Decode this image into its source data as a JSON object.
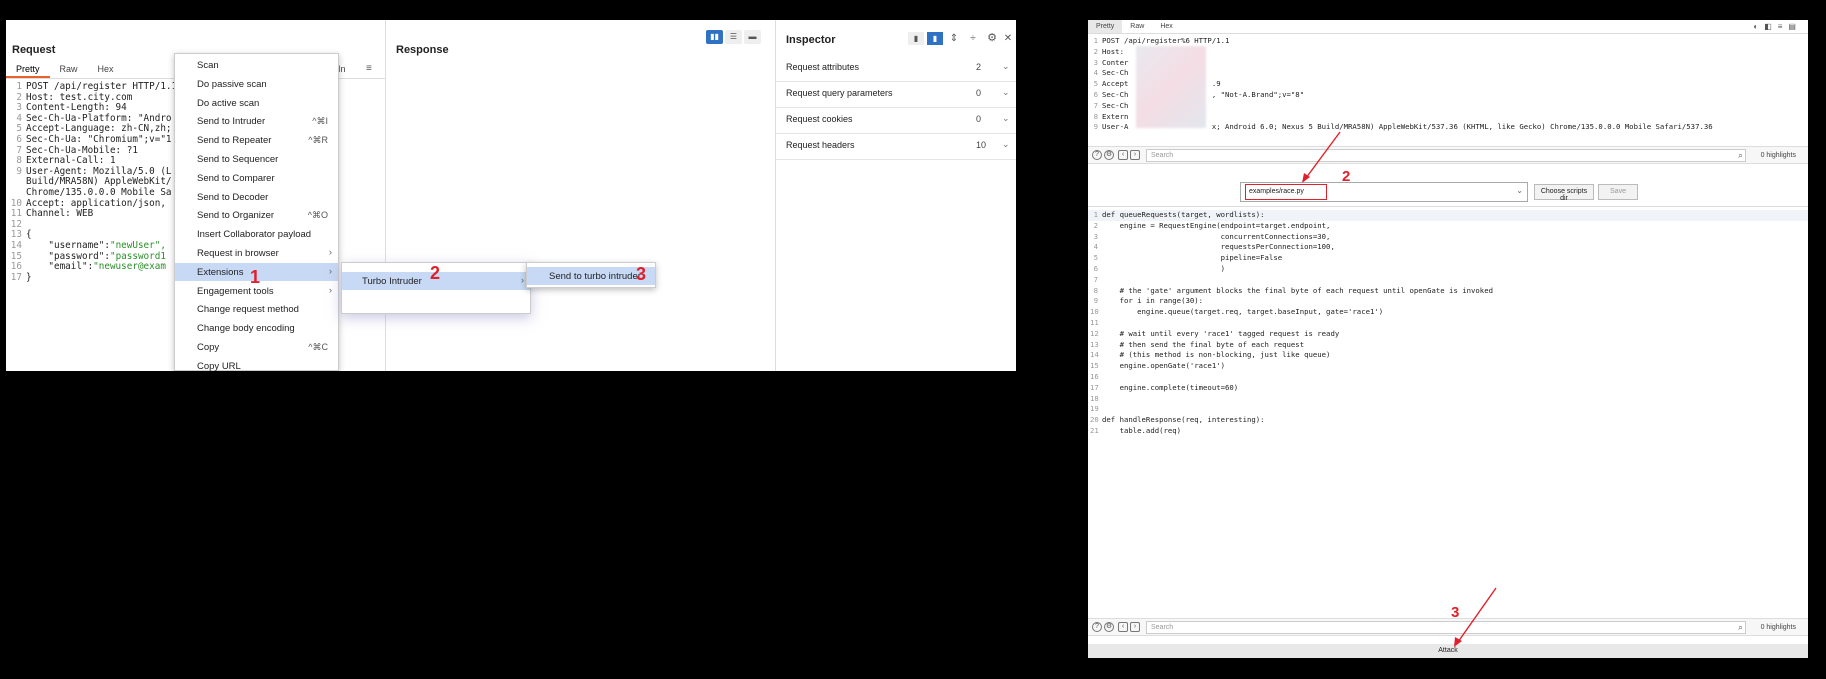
{
  "left": {
    "request": {
      "title": "Request",
      "tabs": [
        "Pretty",
        "Raw",
        "Hex"
      ],
      "lines": [
        {
          "n": "1",
          "text": "POST /api/register HTTP/1.1"
        },
        {
          "n": "2",
          "text": "Host: test.city.com"
        },
        {
          "n": "3",
          "text": "Content-Length: 94"
        },
        {
          "n": "4",
          "text": "Sec-Ch-Ua-Platform: \"Andro"
        },
        {
          "n": "5",
          "text": "Accept-Language: zh-CN,zh;"
        },
        {
          "n": "6",
          "text": "Sec-Ch-Ua: \"Chromium\";v=\"1"
        },
        {
          "n": "7",
          "text": "Sec-Ch-Ua-Mobile: ?1"
        },
        {
          "n": "8",
          "text": "External-Call: 1"
        },
        {
          "n": "9",
          "text": "User-Agent: Mozilla/5.0 (L"
        },
        {
          "n": "",
          "text": "Build/MRA58N) AppleWebKit/"
        },
        {
          "n": "",
          "text": "Chrome/135.0.0.0 Mobile Sa"
        },
        {
          "n": "10",
          "text": "Accept: application/json,"
        },
        {
          "n": "11",
          "text": "Channel: WEB"
        },
        {
          "n": "12",
          "text": ""
        },
        {
          "n": "13",
          "text": "{"
        },
        {
          "n": "14",
          "text": "    \"username\":\"newUser\","
        },
        {
          "n": "15",
          "text": "    \"password\":\"password1"
        },
        {
          "n": "16",
          "text": "    \"email\":\"newuser@exam"
        },
        {
          "n": "17",
          "text": "}"
        }
      ],
      "trail_label": "In"
    },
    "response": {
      "title": "Response"
    },
    "inspector": {
      "title": "Inspector",
      "rows": [
        {
          "label": "Request attributes",
          "count": "2"
        },
        {
          "label": "Request query parameters",
          "count": "0"
        },
        {
          "label": "Request cookies",
          "count": "0"
        },
        {
          "label": "Request headers",
          "count": "10"
        }
      ]
    },
    "context_menu": [
      {
        "label": "Scan",
        "key": ""
      },
      {
        "label": "Do passive scan",
        "key": ""
      },
      {
        "label": "Do active scan",
        "key": ""
      },
      {
        "label": "Send to Intruder",
        "key": "^⌘I"
      },
      {
        "label": "Send to Repeater",
        "key": "^⌘R"
      },
      {
        "label": "Send to Sequencer",
        "key": ""
      },
      {
        "label": "Send to Comparer",
        "key": ""
      },
      {
        "label": "Send to Decoder",
        "key": ""
      },
      {
        "label": "Send to Organizer",
        "key": "^⌘O"
      },
      {
        "label": "Insert Collaborator payload",
        "key": ""
      },
      {
        "label": "Request in browser",
        "key": ""
      },
      {
        "label": "Extensions",
        "key": ""
      },
      {
        "label": "Engagement tools",
        "key": ""
      },
      {
        "label": "Change request method",
        "key": ""
      },
      {
        "label": "Change body encoding",
        "key": ""
      },
      {
        "label": "Copy",
        "key": "^⌘C"
      },
      {
        "label": "Copy URL",
        "key": ""
      }
    ],
    "submenu": {
      "label": "Turbo Intruder"
    },
    "submenu2": {
      "label": "Send to turbo intruder"
    },
    "annotations": [
      "1",
      "2",
      "3"
    ]
  },
  "right": {
    "tabs": [
      "Pretty",
      "Raw",
      "Hex"
    ],
    "request_lines": [
      {
        "n": "1",
        "text": "POST /api/register%6 HTTP/1.1"
      },
      {
        "n": "2",
        "text": "Host:"
      },
      {
        "n": "3",
        "text": "Conter"
      },
      {
        "n": "4",
        "text": "Sec-Ch"
      },
      {
        "n": "5",
        "text": "Accept                   .9"
      },
      {
        "n": "6",
        "text": "Sec-Ch                   , \"Not-A.Brand\";v=\"8\""
      },
      {
        "n": "7",
        "text": "Sec-Ch"
      },
      {
        "n": "8",
        "text": "Extern"
      },
      {
        "n": "9",
        "text": "User-A                   x; Android 6.0; Nexus 5 Build/MRA58N) AppleWebKit/537.36 (KHTML, like Gecko) Chrome/135.0.0.0 Mobile Safari/537.36"
      }
    ],
    "search_placeholder": "Search",
    "highlights": "0 highlights",
    "script_path": "examples/race.py",
    "choose_btn": "Choose scripts dir",
    "save_btn": "Save",
    "script_lines": [
      {
        "n": "1",
        "text": "def queueRequests(target, wordlists):"
      },
      {
        "n": "2",
        "text": "    engine = RequestEngine(endpoint=target.endpoint,"
      },
      {
        "n": "3",
        "text": "                           concurrentConnections=30,"
      },
      {
        "n": "4",
        "text": "                           requestsPerConnection=100,"
      },
      {
        "n": "5",
        "text": "                           pipeline=False"
      },
      {
        "n": "6",
        "text": "                           )"
      },
      {
        "n": "7",
        "text": ""
      },
      {
        "n": "8",
        "text": "    # the 'gate' argument blocks the final byte of each request until openGate is invoked"
      },
      {
        "n": "9",
        "text": "    for i in range(30):"
      },
      {
        "n": "10",
        "text": "        engine.queue(target.req, target.baseInput, gate='race1')"
      },
      {
        "n": "11",
        "text": ""
      },
      {
        "n": "12",
        "text": "    # wait until every 'race1' tagged request is ready"
      },
      {
        "n": "13",
        "text": "    # then send the final byte of each request"
      },
      {
        "n": "14",
        "text": "    # (this method is non-blocking, just like queue)"
      },
      {
        "n": "15",
        "text": "    engine.openGate('race1')"
      },
      {
        "n": "16",
        "text": ""
      },
      {
        "n": "17",
        "text": "    engine.complete(timeout=60)"
      },
      {
        "n": "18",
        "text": ""
      },
      {
        "n": "19",
        "text": ""
      },
      {
        "n": "20",
        "text": "def handleResponse(req, interesting):"
      },
      {
        "n": "21",
        "text": "    table.add(req)"
      }
    ],
    "attack_btn": "Attack",
    "annotations": [
      "2",
      "3"
    ]
  },
  "colors": {
    "accent": "#e8632b",
    "annotation": "#e0202a",
    "highlight": "#c7d9f5"
  }
}
